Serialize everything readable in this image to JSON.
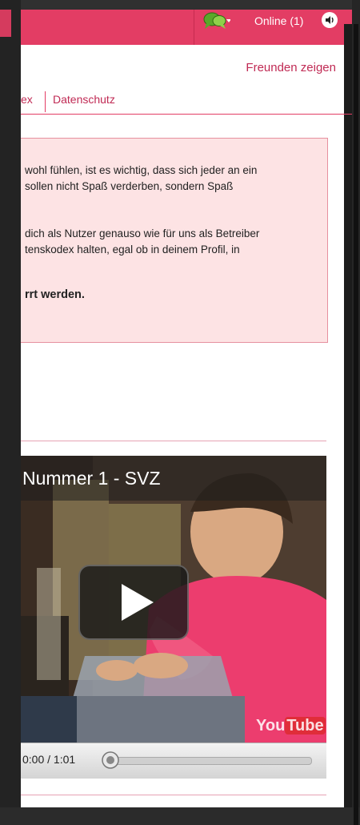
{
  "header": {
    "online_label": "Online (1)"
  },
  "links": {
    "share": "Freunden zeigen"
  },
  "tabs": [
    {
      "label": "ex"
    },
    {
      "label": "Datenschutz"
    }
  ],
  "notice": {
    "lines": [
      "wohl fühlen, ist es wichtig, dass sich jeder an ein",
      " sollen nicht Spaß verderben, sondern Spaß",
      "dich als Nutzer genauso wie für uns als Betreiber",
      "tenskodex halten, egal ob in deinem Profil, in"
    ],
    "bold_line": "rrt werden."
  },
  "video": {
    "title": "Nummer 1 - SVZ",
    "time": "0:00 / 1:01",
    "progress": 0,
    "brand": "YouTube"
  },
  "colors": {
    "header": "#e33d64",
    "accent": "#c02a54",
    "notice_bg": "#fde3e4",
    "notice_border": "#e6909f"
  }
}
